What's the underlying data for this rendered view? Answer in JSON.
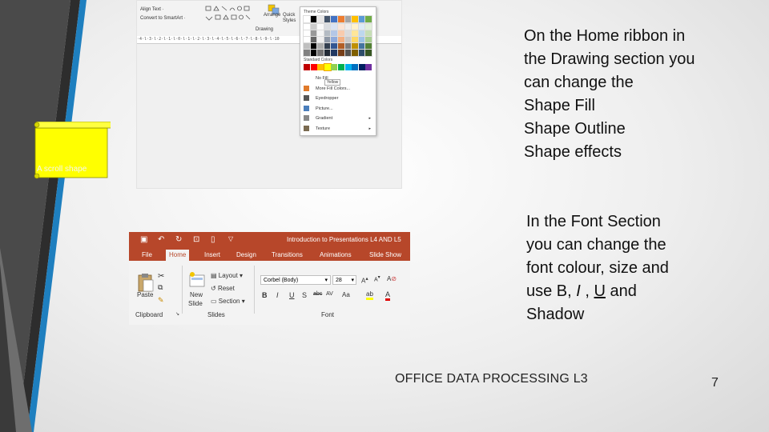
{
  "top_screenshot": {
    "ribbon": {
      "align_text": "Align Text ·",
      "convert_smartart": "Convert to SmartArt ·",
      "drawing_group": "Drawing",
      "arrange": "Arrange",
      "quick_styles": "Quick Styles"
    },
    "ruler": "·4·l·3·l·2·l·1·l·0·l·1·l·2·l·3·l·4·l·5·l·6·l·7·l·8·l·9·l·10",
    "theme_colors_dropdown": {
      "theme_colors_label": "Theme Colors",
      "standard_colors_label": "Standard Colors",
      "yellow_tooltip": "Yellow",
      "items": [
        {
          "label": "No Fill",
          "icon": "no-fill-icon",
          "submenu": false
        },
        {
          "label": "More Fill Colors...",
          "icon": "palette-icon",
          "submenu": false
        },
        {
          "label": "Eyedropper",
          "icon": "eyedropper-icon",
          "submenu": false
        },
        {
          "label": "Picture...",
          "icon": "picture-icon",
          "submenu": false
        },
        {
          "label": "Gradient",
          "icon": "gradient-icon",
          "submenu": true
        },
        {
          "label": "Texture",
          "icon": "texture-icon",
          "submenu": true
        }
      ],
      "theme_swatches": [
        "#ffffff",
        "#000000",
        "#e7e6e6",
        "#44546a",
        "#4472c4",
        "#ed7d31",
        "#a5a5a5",
        "#ffc000",
        "#5b9bd5",
        "#70ad47"
      ],
      "standard_swatches": [
        "#c00000",
        "#ff0000",
        "#ffc000",
        "#ffff00",
        "#92d050",
        "#00b050",
        "#00b0f0",
        "#0070c0",
        "#002060",
        "#7030a0"
      ]
    },
    "shape_label": "A scroll shape",
    "shape_color": "#ffff00"
  },
  "bottom_screenshot": {
    "accent_color": "#b7472a",
    "doc_title": "Introduction to Presentations L4 AND L5",
    "tabs": [
      "File",
      "Home",
      "Insert",
      "Design",
      "Transitions",
      "Animations",
      "Slide Show"
    ],
    "active_tab": "Home",
    "clipboard": {
      "paste": "Paste",
      "group": "Clipboard"
    },
    "slides": {
      "new_slide_line1": "New",
      "new_slide_line2": "Slide",
      "layout": "Layout",
      "reset": "Reset",
      "section": "Section",
      "group": "Slides"
    },
    "font": {
      "font_name": "Corbel (Body)",
      "font_size": "28",
      "bold": "B",
      "italic": "I",
      "underline": "U",
      "shadow": "S",
      "strike": "abc",
      "spacing": "AV",
      "case": "Aa",
      "group": "Font"
    }
  },
  "text": {
    "para1": [
      "On the Home ribbon in",
      "the Drawing section you",
      "can change the",
      "Shape Fill",
      "Shape Outline",
      "Shape effects"
    ],
    "para2": [
      "In the Font Section",
      "you can change the",
      "font colour, size and"
    ],
    "para2_line4_pre": "use B, ",
    "para2_line4_i": "I",
    "para2_line4_mid": " , ",
    "para2_line4_u": "U",
    "para2_line4_post": " and",
    "para2_line5": "Shadow"
  },
  "footer": "OFFICE DATA PROCESSING L3",
  "page_number": "7"
}
